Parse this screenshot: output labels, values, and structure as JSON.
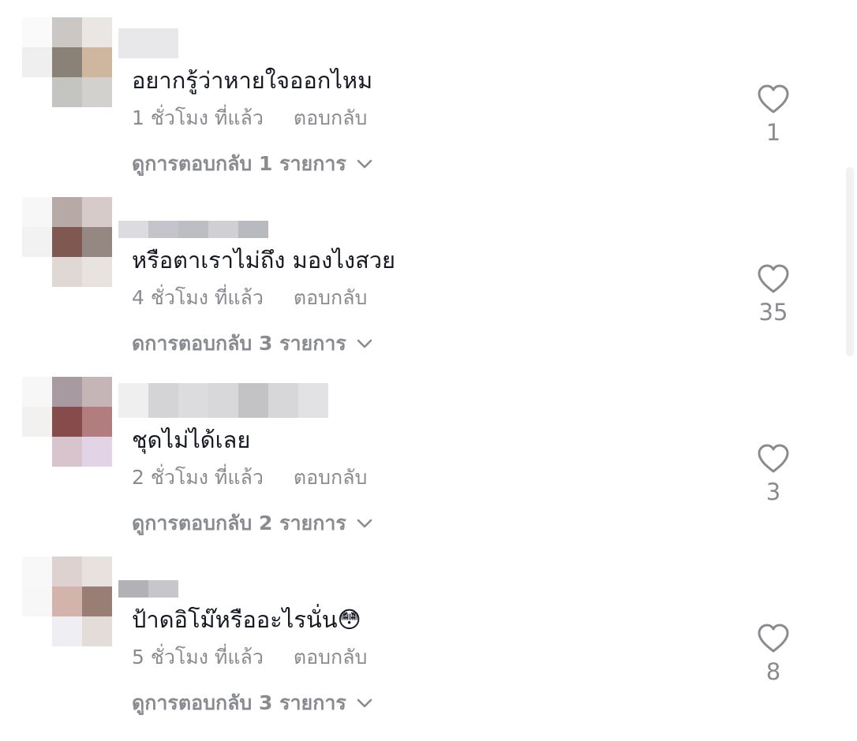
{
  "colors": {
    "primary_text": "#161823",
    "secondary_text": "#8a8b91",
    "background": "#ffffff"
  },
  "icons": {
    "like": "heart-outline-icon",
    "expand": "chevron-down-icon"
  },
  "comments": [
    {
      "text": "อยากรู้ว่าหายใจออกไหม",
      "time": "1 ชั่วโมง ที่แล้ว",
      "reply_label": "ตอบกลับ",
      "view_replies": "ดูการตอบกลับ 1 รายการ",
      "likes": "1"
    },
    {
      "text": "หรือตาเราไม่ถึง มองไงสวย",
      "time": "4 ชั่วโมง ที่แล้ว",
      "reply_label": "ตอบกลับ",
      "view_replies": "ดการตอบกลับ 3 รายการ",
      "likes": "35"
    },
    {
      "text": "ชุดไม่ได้เลย",
      "time": "2 ชั่วโมง ที่แล้ว",
      "reply_label": "ตอบกลับ",
      "view_replies": "ดูการตอบกลับ 2 รายการ",
      "likes": "3"
    },
    {
      "text": "ป้าดอิโม๊หรืออะไรนั่น😳",
      "time": "5 ชั่วโมง ที่แล้ว",
      "reply_label": "ตอบกลับ",
      "view_replies": "ดูการตอบกลับ 3 รายการ",
      "likes": "8"
    }
  ]
}
